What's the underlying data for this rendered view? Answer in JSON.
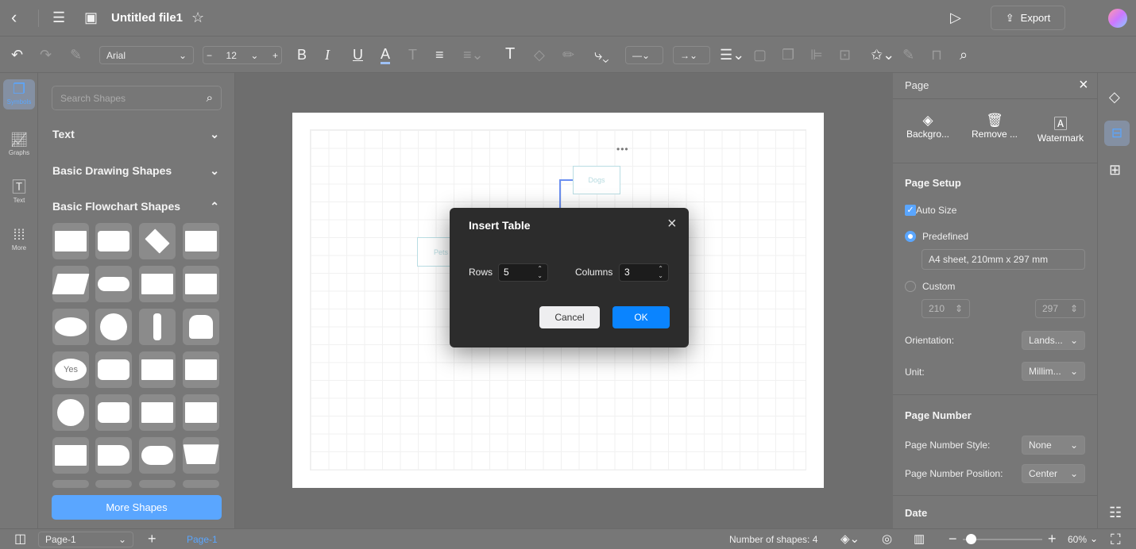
{
  "header": {
    "title": "Untitled file1",
    "export_label": "Export"
  },
  "toolbar": {
    "font": "Arial",
    "font_size": "12",
    "underline_color": "#9ec1f5"
  },
  "rail": {
    "items": [
      {
        "label": "Symbols",
        "icon": "symbols-icon",
        "active": true
      },
      {
        "label": "Graphs",
        "icon": "graph-icon"
      },
      {
        "label": "Text",
        "icon": "text-icon"
      },
      {
        "label": "More",
        "icon": "grid-dots-icon"
      }
    ]
  },
  "shapes_panel": {
    "search_placeholder": "Search Shapes",
    "sections": [
      "Text",
      "Basic Drawing Shapes",
      "Basic Flowchart Shapes"
    ],
    "yes_label": "Yes",
    "more_shapes": "More Shapes"
  },
  "canvas": {
    "nodes": [
      "Dogs",
      "Pets"
    ]
  },
  "dialog": {
    "title": "Insert Table",
    "rows_label": "Rows",
    "rows_value": "5",
    "columns_label": "Columns",
    "columns_value": "3",
    "cancel": "Cancel",
    "ok": "OK",
    "ok_color": "#0a84ff"
  },
  "right_panel": {
    "title": "Page",
    "actions": [
      "Backgro...",
      "Remove ...",
      "Watermark"
    ],
    "page_setup": {
      "heading": "Page Setup",
      "auto_size": "Auto Size",
      "auto_size_checked": true,
      "predefined": "Predefined",
      "predefined_selected": true,
      "predefined_value": "A4 sheet, 210mm x 297 mm",
      "custom": "Custom",
      "width": "210",
      "height": "297",
      "orientation_label": "Orientation:",
      "orientation": "Lands...",
      "unit_label": "Unit:",
      "unit": "Millim..."
    },
    "page_number": {
      "heading": "Page Number",
      "style_label": "Page Number Style:",
      "style": "None",
      "position_label": "Page Number Position:",
      "position": "Center"
    },
    "date_heading": "Date"
  },
  "bottom": {
    "page_select": "Page-1",
    "page_tab": "Page-1",
    "shape_count": "Number of shapes: 4",
    "zoom": "60%",
    "zoom_fraction": 0.1
  },
  "accent": "#5aa6ff"
}
